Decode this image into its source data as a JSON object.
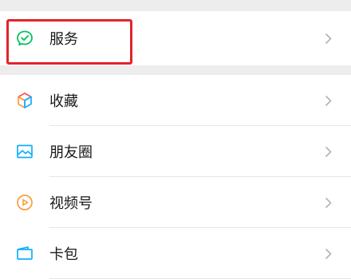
{
  "menu": {
    "items": [
      {
        "label": "服务",
        "icon": "service-check-icon",
        "color": "#07c160"
      },
      {
        "label": "收藏",
        "icon": "favorites-cube-icon",
        "color": "#fa9d3b"
      },
      {
        "label": "朋友圈",
        "icon": "moments-image-icon",
        "color": "#10aeff"
      },
      {
        "label": "视频号",
        "icon": "channels-play-icon",
        "color": "#fa9d3b"
      },
      {
        "label": "卡包",
        "icon": "card-wallet-icon",
        "color": "#10aeff"
      }
    ],
    "chevron_color": "#b2b2b2"
  },
  "highlight_color": "#e3232c"
}
